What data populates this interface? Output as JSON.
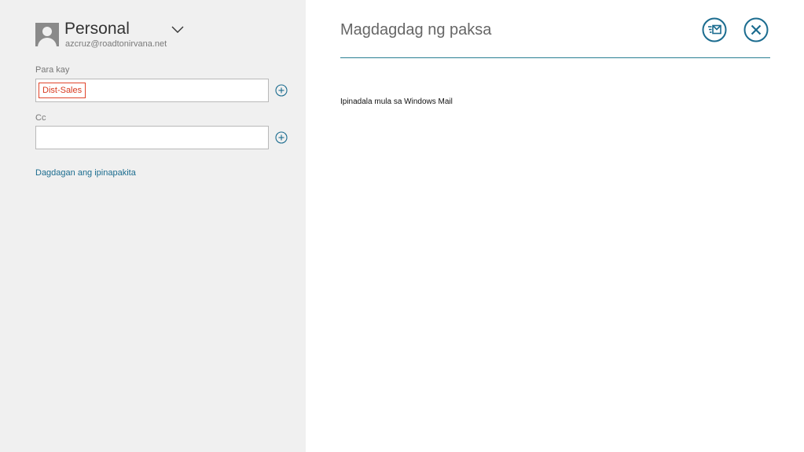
{
  "account": {
    "name": "Personal",
    "email": "azcruz@roadtonirvana.net"
  },
  "to": {
    "label": "Para kay",
    "recipients": [
      "Dist-Sales"
    ]
  },
  "cc": {
    "label": "Cc",
    "value": ""
  },
  "more_link": "Dagdagan ang ipinapakita",
  "subject": {
    "placeholder": "Magdagdag ng paksa"
  },
  "message": {
    "signature": "Ipinadala mula sa Windows Mail"
  },
  "icons": {
    "send": "send-icon",
    "close": "close-icon",
    "add": "add-circle-icon",
    "chevron": "chevron-down-icon"
  },
  "colors": {
    "accent": "#2a7f93",
    "recipient_chip": "#d8391e",
    "left_panel_bg": "#f0f0f0"
  }
}
